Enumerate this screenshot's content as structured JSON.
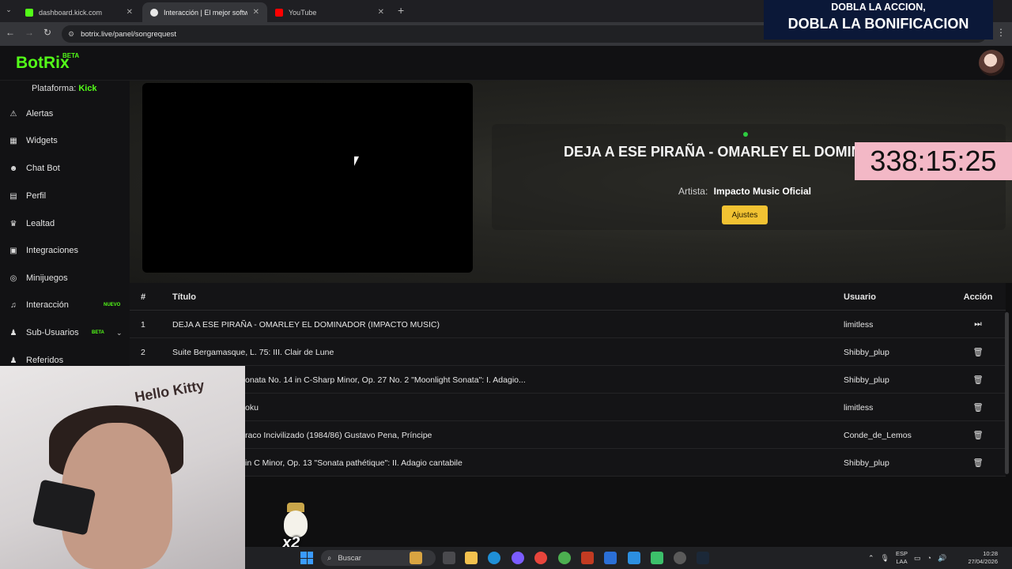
{
  "browser": {
    "tabs": [
      {
        "title": "dashboard.kick.com",
        "fav_color": "#53fc18",
        "active": false
      },
      {
        "title": "Interacción | El mejor software",
        "fav_color": "#e8e8e8",
        "active": true
      },
      {
        "title": "YouTube",
        "fav_color": "#ff0000",
        "active": false
      }
    ],
    "close_glyph": "✕",
    "new_tab_glyph": "+",
    "url": "botrix.live/panel/songrequest"
  },
  "promo": {
    "line1": "DOBLA LA ACCION,",
    "line2": "DOBLA LA BONIFICACION"
  },
  "app": {
    "logo": "BotRix",
    "logo_badge": "BETA"
  },
  "sidebar": {
    "platform_label": "Plataforma:",
    "platform_value": "Kick",
    "items": [
      {
        "label": "Alertas",
        "icon": "warning-icon",
        "glyph": "⚠"
      },
      {
        "label": "Widgets",
        "icon": "grid-icon",
        "glyph": "▦"
      },
      {
        "label": "Chat Bot",
        "icon": "robot-icon",
        "glyph": "☻"
      },
      {
        "label": "Perfil",
        "icon": "id-card-icon",
        "glyph": "▤"
      },
      {
        "label": "Lealtad",
        "icon": "trophy-icon",
        "glyph": "♛"
      },
      {
        "label": "Integraciones",
        "icon": "plug-icon",
        "glyph": "▣"
      },
      {
        "label": "Minijuegos",
        "icon": "gamepad-icon",
        "glyph": "◎"
      },
      {
        "label": "Interacción",
        "icon": "music-icon",
        "glyph": "♫",
        "badge": "NUEVO"
      },
      {
        "label": "Sub-Usuarios",
        "icon": "users-icon",
        "glyph": "♟",
        "badge": "BETA"
      },
      {
        "label": "Referidos",
        "icon": "user-plus-icon",
        "glyph": "♟"
      }
    ]
  },
  "now_playing": {
    "title": "DEJA A ESE PIRAÑA - OMARLEY EL DOMINA MUSIC)",
    "artist_label": "Artista:",
    "artist": "Impacto Music Oficial",
    "settings_label": "Ajustes"
  },
  "timer": "338:15:25",
  "queue": {
    "headers": {
      "num": "#",
      "title": "Título",
      "user": "Usuario",
      "action": "Acción"
    },
    "rows": [
      {
        "num": "1",
        "title": "DEJA A ESE PIRAÑA - OMARLEY EL DOMINADOR (IMPACTO MUSIC)",
        "user": "limitless",
        "action": "skip"
      },
      {
        "num": "2",
        "title": "Suite Bergamasque, L. 75: III. Clair de Lune",
        "user": "Shibby_plup",
        "action": "delete"
      },
      {
        "num": "",
        "title": "onata No. 14 in C-Sharp Minor, Op. 27 No. 2 \"Moonlight Sonata\": I. Adagio...",
        "user": "Shibby_plup",
        "action": "delete"
      },
      {
        "num": "",
        "title": "oku",
        "user": "limitless",
        "action": "delete"
      },
      {
        "num": "",
        "title": "raco Incivilizado (1984/86) Gustavo Pena, Príncipe",
        "user": "Conde_de_Lemos",
        "action": "delete"
      },
      {
        "num": "",
        "title": "in C Minor, Op. 13 \"Sonata pathétique\": II. Adagio cantabile",
        "user": "Shibby_plup",
        "action": "delete"
      }
    ]
  },
  "overlay": {
    "webcam_sign": "Hello Kitty",
    "goose_label": "x2"
  },
  "taskbar": {
    "search_placeholder": "Buscar",
    "lang_top": "ESP",
    "lang_bottom": "LAA",
    "time": "10:28",
    "date": "27/04/2026",
    "start_color": "#3a9bff"
  }
}
